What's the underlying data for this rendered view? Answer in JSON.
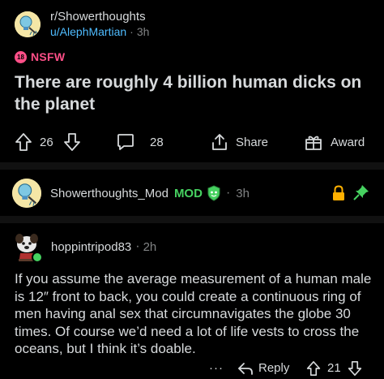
{
  "post": {
    "subreddit": "r/Showerthoughts",
    "author": "u/AlephMartian",
    "separator": "·",
    "age": "3h",
    "nsfw_badge": "18",
    "nsfw_label": "NSFW",
    "title": "There are roughly 4 billion human dicks on the planet",
    "upvotes": "26",
    "comments": "28",
    "share_label": "Share",
    "award_label": "Award"
  },
  "mod_comment": {
    "author": "Showerthoughts_Mod",
    "badge": "MOD",
    "separator": "·",
    "age": "3h"
  },
  "comment": {
    "author": "hoppintripod83",
    "separator": "·",
    "age": "2h",
    "body": "If you assume the average measurement of a human male is 12″ front to back, you could create a continuous ring of men having anal sex that circumnavigates the globe 30 times. Of course we’d need a lot of life vests to cross the oceans, but I think it’s doable.",
    "more": "···",
    "reply_label": "Reply",
    "votes": "21"
  },
  "icons": [
    "subreddit-icon",
    "upvote-icon",
    "downvote-icon",
    "comment-icon",
    "share-icon",
    "award-icon",
    "shield-icon",
    "lock-icon",
    "pin-icon",
    "reply-icon",
    "more-icon"
  ],
  "colors": {
    "background": "#000000",
    "text": "#d7dadc",
    "muted": "#818384",
    "username": "#4fbcff",
    "nsfw": "#ff4f88",
    "mod": "#46d160",
    "lock": "#ffb000"
  }
}
